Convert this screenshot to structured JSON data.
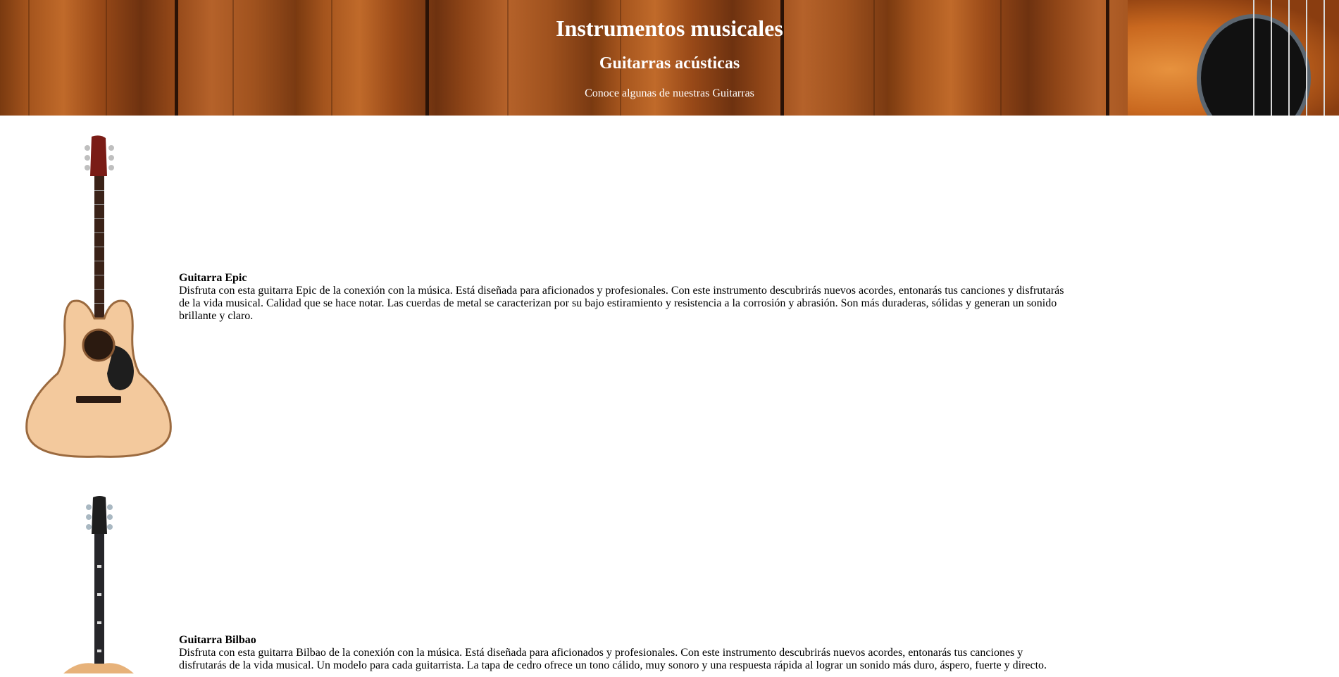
{
  "header": {
    "title": "Instrumentos musicales",
    "subtitle": "Guitarras acústicas",
    "tagline": "Conoce algunas de nuestras Guitarras"
  },
  "products": [
    {
      "name": "Guitarra Epic",
      "description": "Disfruta con esta guitarra Epic de la conexión con la música. Está diseñada para aficionados y profesionales. Con este instrumento descubrirás nuevos acordes, entonarás tus canciones y disfrutarás de la vida musical. Calidad que se hace notar. Las cuerdas de metal se caracterizan por su bajo estiramiento y resistencia a la corrosión y abrasión. Son más duraderas, sólidas y generan un sonido brillante y claro.",
      "image_icon": "acoustic-guitar-natural"
    },
    {
      "name": "Guitarra Bilbao",
      "description": "Disfruta con esta guitarra Bilbao de la conexión con la música. Está diseñada para aficionados y profesionales. Con este instrumento descubrirás nuevos acordes, entonarás tus canciones y disfrutarás de la vida musical. Un modelo para cada guitarrista. La tapa de cedro ofrece un tono cálido, muy sonoro y una respuesta rápida al lograr un sonido más duro, áspero, fuerte y directo.",
      "image_icon": "acoustic-guitar-black-neck"
    }
  ]
}
